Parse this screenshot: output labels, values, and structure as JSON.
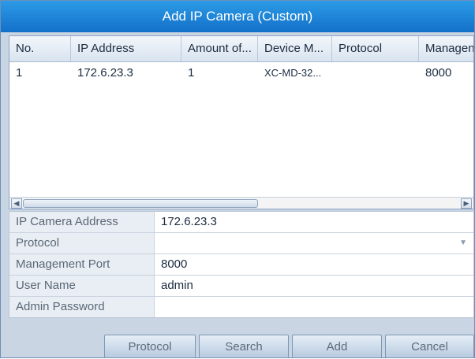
{
  "dialog": {
    "title": "Add IP Camera (Custom)"
  },
  "list": {
    "columns": [
      "No.",
      "IP Address",
      "Amount of...",
      "Device M...",
      "Protocol",
      "Managen"
    ],
    "rows": [
      [
        "1",
        "172.6.23.3",
        "1",
        "XC-MD-32...",
        "",
        "8000"
      ]
    ],
    "scroll_left_glyph": "◀",
    "scroll_right_glyph": "▶"
  },
  "form": {
    "ip_camera_address": {
      "label": "IP Camera Address",
      "value": "172.6.23.3"
    },
    "protocol": {
      "label": "Protocol",
      "value": "",
      "arrow_icon": "chevron-down-icon"
    },
    "management_port": {
      "label": "Management Port",
      "value": "8000"
    },
    "user_name": {
      "label": "User Name",
      "value": "admin"
    },
    "admin_password": {
      "label": "Admin Password",
      "value": ""
    }
  },
  "buttons": {
    "protocol": "Protocol",
    "search": "Search",
    "add": "Add",
    "cancel": "Cancel"
  },
  "colors": {
    "title_bar": "#1d86d8",
    "dialog_bg": "#c9d5e3"
  }
}
